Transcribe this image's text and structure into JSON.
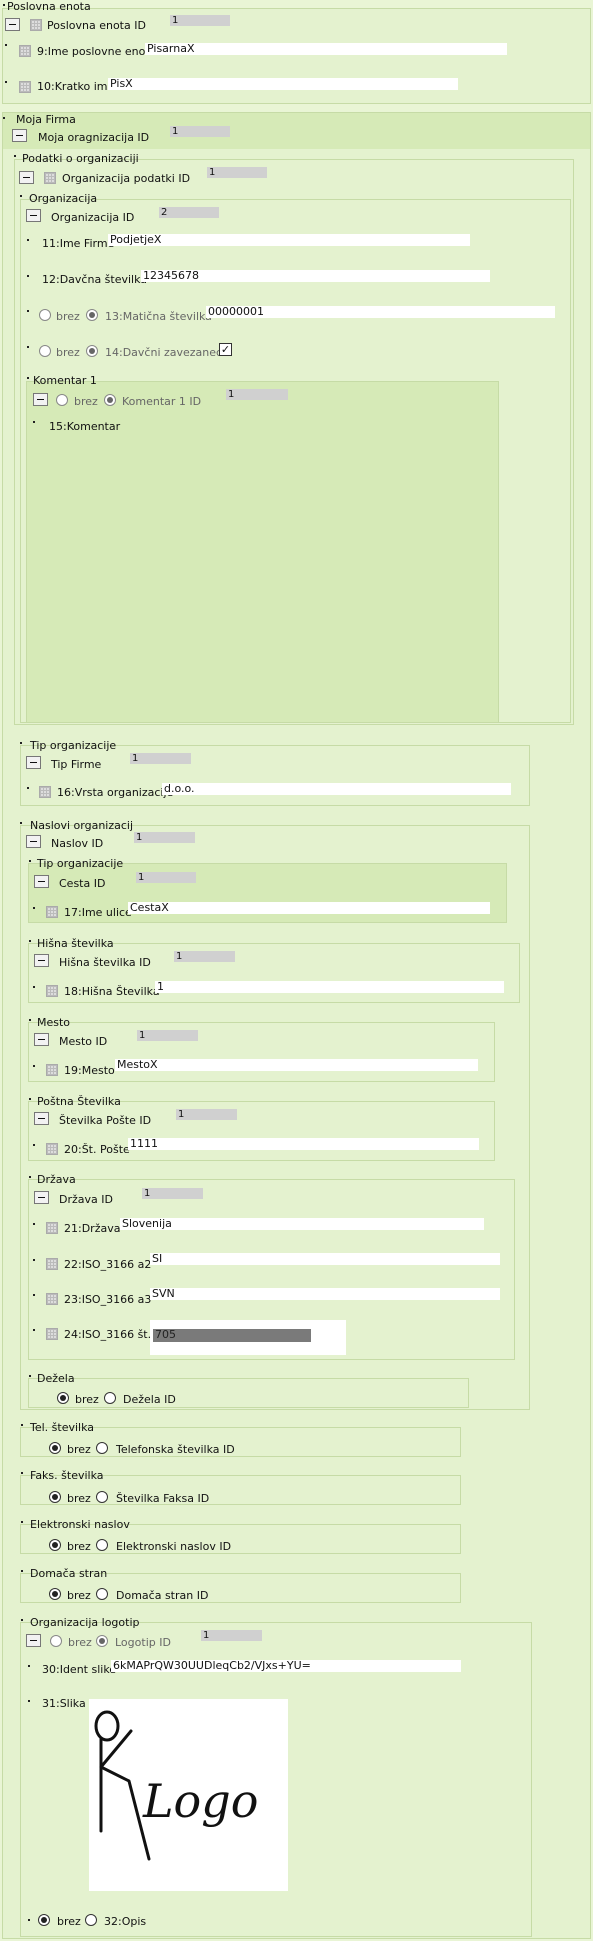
{
  "poslovna_enota": {
    "title": "Poslovna enota",
    "id_label": "Poslovna enota ID",
    "id_value": "1",
    "ime_label": "9:Ime poslovne enote",
    "ime_value": "PisarnaX",
    "kratko_label": "10:Kratko ime",
    "kratko_value": "PisX"
  },
  "moja_firma": {
    "title": "Moja Firma",
    "id_label": "Moja oragnizacija ID",
    "id_value": "1",
    "podatki": {
      "title": "Podatki o organizaciji",
      "id_label": "Organizacija podatki ID",
      "id_value": "1",
      "organizacija": {
        "title": "Organizacija",
        "id_label": "Organizacija ID",
        "id_value": "2",
        "ime_label": "11:Ime Firme",
        "ime_value": "PodjetjeX",
        "davcna_label": "12:Davčna številka",
        "davcna_value": "12345678",
        "brez_label": "brez",
        "maticna_label": "13:Matična številka",
        "maticna_value": "00000001",
        "brez2_label": "brez",
        "zavezanec_label": "14:Davčni zavezanec",
        "zavezanec_check": "✓",
        "komentar": {
          "title": "Komentar 1",
          "brez_label": "brez",
          "id_label": "Komentar 1 ID",
          "id_value": "1",
          "komentar_label": "15:Komentar"
        }
      }
    },
    "tip_organizacije": {
      "title": "Tip organizacije",
      "id_label": "Tip Firme",
      "id_value": "1",
      "vrsta_label": "16:Vrsta organizacije",
      "vrsta_value": "d.o.o."
    },
    "naslovi": {
      "title": "Naslovi organizacij",
      "id_label": "Naslov ID",
      "id_value": "1",
      "cesta": {
        "title": "Tip organizacije",
        "id_label": "Cesta ID",
        "id_value": "1",
        "label": "17:Ime ulice",
        "value": "CestaX"
      },
      "hisna": {
        "title": "Hišna številka",
        "id_label": "Hišna številka ID",
        "id_value": "1",
        "label": "18:Hišna Številka",
        "value": "1"
      },
      "mesto": {
        "title": "Mesto",
        "id_label": "Mesto ID",
        "id_value": "1",
        "label": "19:Mesto",
        "value": "MestoX"
      },
      "posta": {
        "title": "Poštna Številka",
        "id_label": "Številka Pošte ID",
        "id_value": "1",
        "label": "20:Št. Pošte",
        "value": "1111"
      },
      "drzava": {
        "title": "Država",
        "id_label": "Država ID",
        "id_value": "1",
        "l21": "21:Država",
        "v21": "Slovenija",
        "l22": "22:ISO_3166 a2",
        "v22": "SI",
        "l23": "23:ISO_3166 a3",
        "v23": "SVN",
        "l24": "24:ISO_3166 št.",
        "v24": "705"
      },
      "dezela": {
        "title": "Dežela",
        "brez": "brez",
        "id_label": "Dežela ID"
      }
    },
    "tel": {
      "title": "Tel. številka",
      "brez": "brez",
      "id_label": "Telefonska številka ID"
    },
    "faks": {
      "title": "Faks. številka",
      "brez": "brez",
      "id_label": "Številka Faksa ID"
    },
    "email": {
      "title": "Elektronski naslov",
      "brez": "brez",
      "id_label": "Elektronski naslov ID"
    },
    "web": {
      "title": "Domača stran",
      "brez": "brez",
      "id_label": "Domača stran ID"
    },
    "logotip": {
      "title": "Organizacija logotip",
      "brez": "brez",
      "id_label": "Logotip ID",
      "id_value": "1",
      "ident_label": "30:Ident slike",
      "ident_value": "6kMAPrQW30UUDleqCb2/VJxs+YU=",
      "slika_label": "31:Slika",
      "logo_text": "Logo",
      "brez2": "brez",
      "opis_label": "32:Opis"
    }
  }
}
